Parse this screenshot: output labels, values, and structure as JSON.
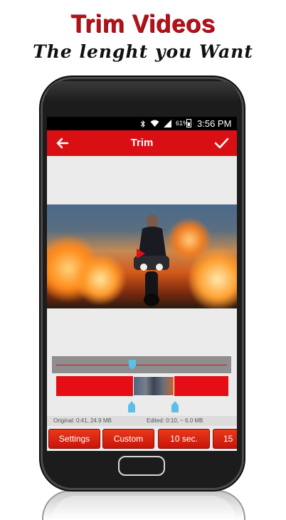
{
  "promo": {
    "title": "Trim Videos",
    "subtitle": "The lenght you Want"
  },
  "status_bar": {
    "battery_percent": "61%",
    "time": "3:56 PM",
    "icons": [
      "bluetooth-icon",
      "wifi-icon",
      "signal-icon",
      "battery-icon"
    ]
  },
  "toolbar": {
    "title": "Trim",
    "back_icon": "arrow-left-icon",
    "done_icon": "checkmark-icon"
  },
  "info": {
    "original": "Original: 0:41, 24.9 MB",
    "edited": "Edited: 0:10, ~ 6.0 MB"
  },
  "buttons": [
    {
      "label": "Settings"
    },
    {
      "label": "Custom"
    },
    {
      "label": "10 sec."
    },
    {
      "label": "15"
    }
  ],
  "colors": {
    "accent": "#d90f14",
    "handle": "#5bc0e8",
    "title_red": "#b3121a"
  }
}
